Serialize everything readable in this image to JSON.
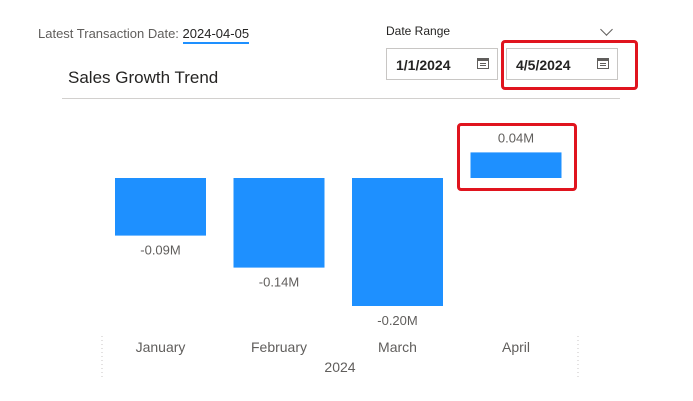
{
  "latest": {
    "label": "Latest Transaction Date:",
    "date": "2024-04-05"
  },
  "title": "Sales Growth Trend",
  "date_range": {
    "label": "Date Range",
    "start": "1/1/2024",
    "end": "4/5/2024"
  },
  "colors": {
    "bar": "#1e90ff",
    "highlight": "#e0141e"
  },
  "chart_data": {
    "type": "bar",
    "categories": [
      "January",
      "February",
      "March",
      "April"
    ],
    "values": [
      -0.09,
      -0.14,
      -0.2,
      0.04
    ],
    "data_labels": [
      "-0.09M",
      "-0.14M",
      "-0.20M",
      "0.04M"
    ],
    "unit": "M",
    "year_label": "2024",
    "ylim": [
      -0.2,
      0.04
    ],
    "grid": false,
    "legend": "none"
  }
}
